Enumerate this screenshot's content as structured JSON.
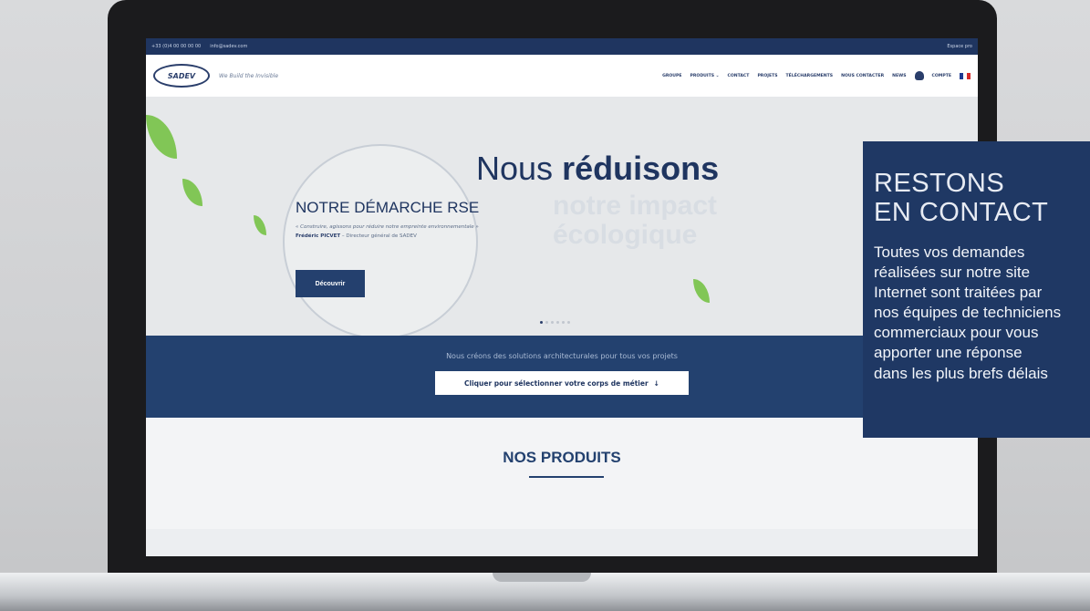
{
  "topbar": {
    "phone": "+33 (0)4 00 00 00 00",
    "email": "info@sadev.com",
    "right": "Espace pro"
  },
  "navbar": {
    "logo": "SADEV",
    "tagline": "We Build the Invisible",
    "menu": [
      "GROUPE",
      "PRODUITS ⌄",
      "CONTACT",
      "PROJETS",
      "TÉLÉCHARGEMENTS",
      "NOUS CONTACTER",
      "NEWS",
      "COMPTE"
    ]
  },
  "hero": {
    "title_light": "Nous",
    "title_bold": "réduisons",
    "ghost_line1": "notre impact",
    "ghost_line2": "écologique",
    "rse_title": "NOTRE DÉMARCHE RSE",
    "quote": "« Construire, agissons pour réduire notre empreinte environnementale »",
    "author_name": "Frédéric PICVET",
    "author_role": " – Directeur général de SADEV",
    "cta": "Découvrir"
  },
  "band": {
    "text": "Nous créons des solutions architecturales pour tous vos projets",
    "button": "Cliquer pour sélectionner votre corps de métier",
    "arrow": "↓"
  },
  "products": {
    "title": "NOS PRODUITS"
  },
  "contact": {
    "title_line1": "RESTONS",
    "title_line2": "EN CONTACT",
    "body_lines": [
      "Toutes vos demandes",
      "réalisées sur notre site",
      "Internet sont traitées par",
      "nos équipes de techniciens",
      "commerciaux pour vous",
      "apporter une réponse",
      "dans les plus brefs délais"
    ]
  },
  "colors": {
    "navy": "#1f3864",
    "leaf_green": "#6fbf3c"
  }
}
